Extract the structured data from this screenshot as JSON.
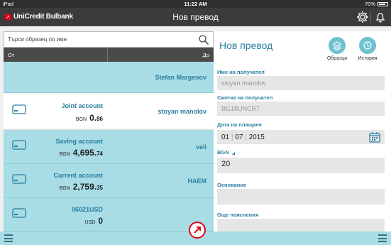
{
  "status_bar": {
    "device": "iPad",
    "time": "11:22 AM",
    "battery": "70%"
  },
  "header": {
    "brand": "UniCredit Bulbank",
    "title": "Нов превод"
  },
  "left_panel": {
    "search_placeholder": "Търси образец по име",
    "col_from": "От",
    "col_to": "До",
    "rows": [
      {
        "account": "",
        "currency": "",
        "amount_int": "",
        "amount_dec": "",
        "recipient": "Stefan Margenov",
        "selected": false
      },
      {
        "account": "Joint account",
        "currency": "BGN",
        "amount_int": "0.",
        "amount_dec": "86",
        "recipient": "stoyan manolov",
        "selected": true
      },
      {
        "account": "Saving account",
        "currency": "BGN",
        "amount_int": "4,695.",
        "amount_dec": "74",
        "recipient": "veli",
        "selected": false
      },
      {
        "account": "Current account",
        "currency": "BGN",
        "amount_int": "2,759.",
        "amount_dec": "35",
        "recipient": "HAEM",
        "selected": false
      },
      {
        "account": "96021USD",
        "currency": "USD",
        "amount_int": "0",
        "amount_dec": "",
        "recipient": "",
        "selected": false
      }
    ]
  },
  "form": {
    "title": "Нов превод",
    "btn_templates": "Образци",
    "btn_history": "История",
    "recipient_name_label": "Име на получател",
    "recipient_name_value": "stoyan manolov",
    "recipient_account_label": "Сметка на получател",
    "recipient_account_value": "BG18UNCR7",
    "payment_date_label": "Дата на плащане",
    "date_day": "01",
    "date_month": "07",
    "date_year": "2015",
    "currency_label": "BGN",
    "amount_value": "20",
    "reason_label": "Основание",
    "notes_label": "Още пояснения"
  },
  "colors": {
    "accent": "#2a7fa0",
    "row_bg": "#a8dde6",
    "header_bg": "#3b3b3b",
    "brand_red": "#e3001b"
  }
}
